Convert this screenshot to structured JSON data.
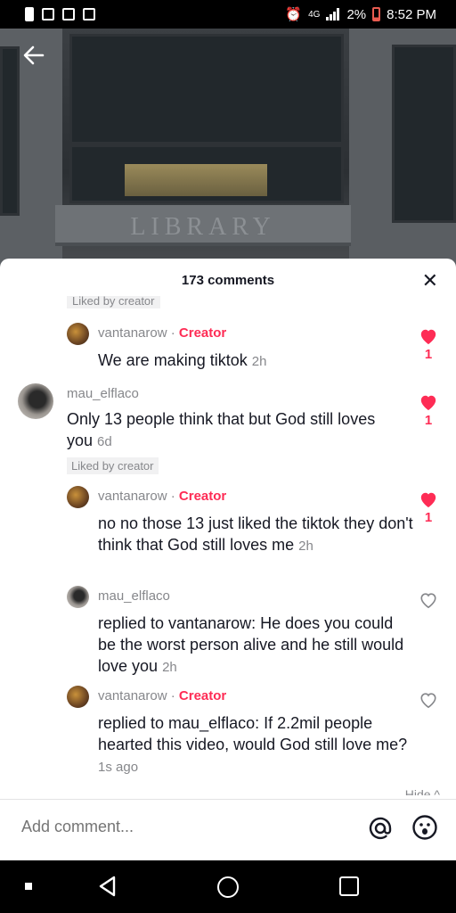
{
  "status_bar": {
    "time": "8:52 PM",
    "battery": "2%",
    "network": "4G"
  },
  "video": {
    "sign_text": "LIBRARY"
  },
  "sheet": {
    "title": "173 comments",
    "close_symbol": "✕"
  },
  "comments": [
    {
      "username": "vantanarow",
      "badge": "Creator",
      "text": "We are making tiktok",
      "time": "2h",
      "likes": "1",
      "liked": true
    },
    {
      "username": "mau_elflaco",
      "text": "Only 13 people think that but God still loves you",
      "time": "6d",
      "likes": "1",
      "liked": true,
      "liked_by_creator": "Liked by creator"
    },
    {
      "username": "vantanarow",
      "badge": "Creator",
      "text": "no no those 13 just liked the tiktok they don't think that God still loves me",
      "time": "2h",
      "likes": "1",
      "liked": true
    },
    {
      "username": "mau_elflaco",
      "text": "replied to vantanarow: He does you could be the worst person alive and he still would love you",
      "time": "2h",
      "liked": false
    },
    {
      "username": "vantanarow",
      "badge": "Creator",
      "text": "replied to mau_elflaco: If 2.2mil people hearted this video, would God still love me?",
      "time": "1s ago",
      "liked": false
    }
  ],
  "partial_liked_label": "Liked by creator",
  "hide_label": "Hide ^",
  "add_comment": {
    "placeholder": "Add comment..."
  },
  "colors": {
    "accent": "#fe2c55",
    "muted": "#86878b",
    "text": "#161823"
  }
}
